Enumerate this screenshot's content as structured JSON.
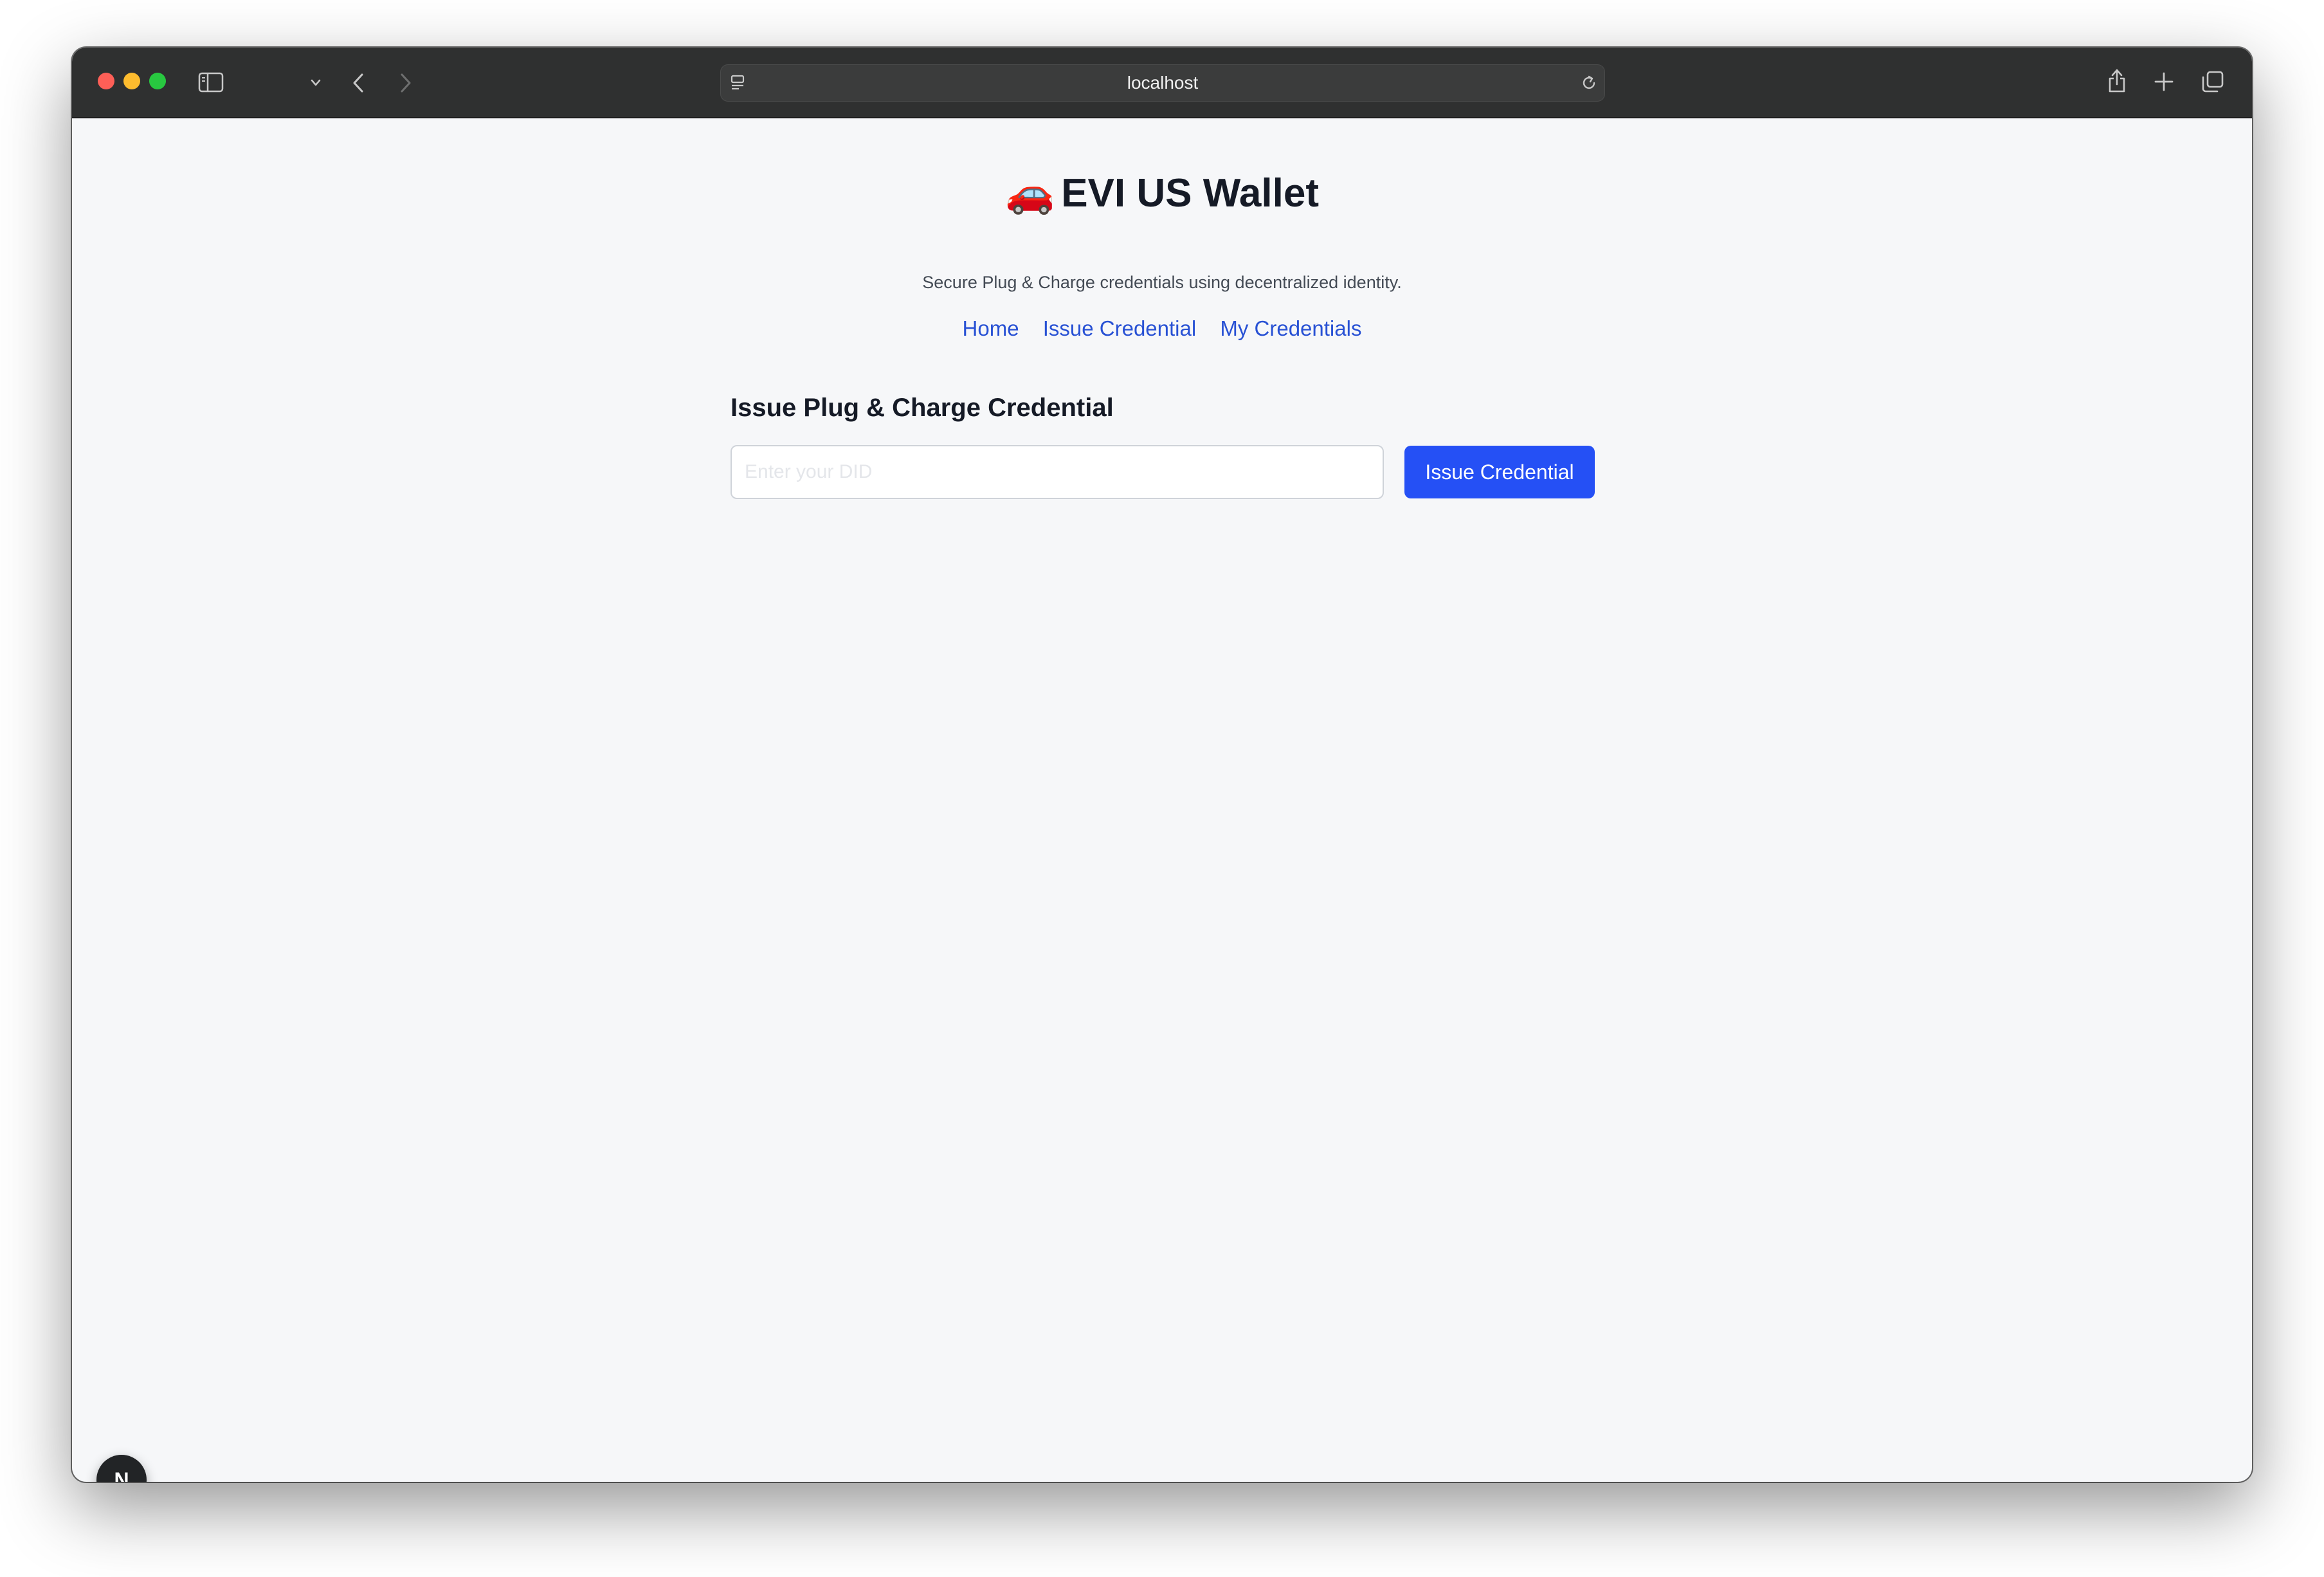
{
  "browser": {
    "url": "localhost",
    "icons": [
      "sidebar-icon",
      "chevron-down-icon",
      "back-arrow-icon",
      "forward-arrow-icon",
      "page-menu-icon",
      "reload-icon",
      "share-icon",
      "new-tab-icon",
      "tabs-overview-icon"
    ]
  },
  "page": {
    "title_emoji": "🚗",
    "title": "EVI US Wallet",
    "subtitle": "Secure Plug & Charge credentials using decentralized identity.",
    "nav": {
      "home": "Home",
      "issue_credential": "Issue Credential",
      "my_credentials": "My Credentials"
    },
    "form": {
      "heading": "Issue Plug & Charge Credential",
      "did_placeholder": "Enter your DID",
      "did_value": "",
      "submit_label": "Issue Credential"
    }
  },
  "dev_badge": {
    "letter": "N"
  },
  "colors": {
    "accent": "#2550f5",
    "link": "#2851d4",
    "background": "#f6f7f9",
    "toolbar": "#2f3030"
  }
}
